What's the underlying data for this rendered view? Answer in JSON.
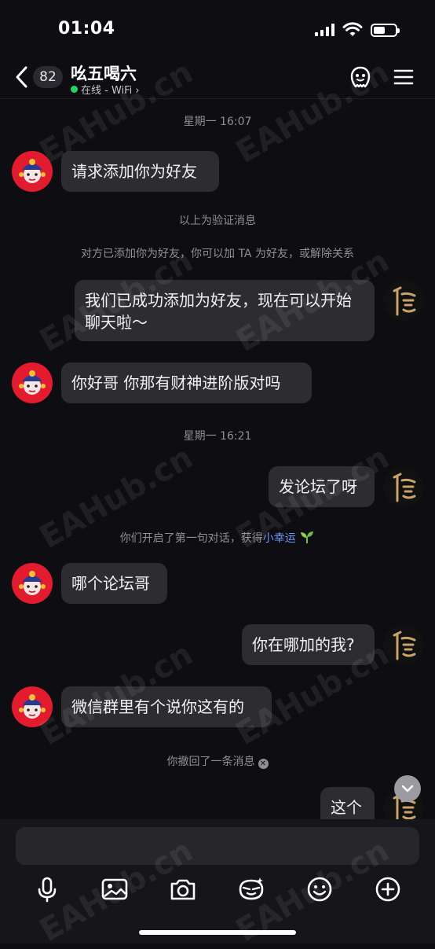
{
  "status": {
    "time": "01:04"
  },
  "header": {
    "unread": "82",
    "title": "吆五喝六",
    "status": "在线 - WiFi ›"
  },
  "chat": {
    "ts1": "星期一 16:07",
    "m1": "请求添加你为好友",
    "sys1": "以上为验证消息",
    "sys2": "对方已添加你为好友，你可以加 TA 为好友，或解除关系",
    "m2": "我们已成功添加为好友，现在可以开始聊天啦～",
    "m3": "你好哥 你那有财神进阶版对吗",
    "ts2": "星期一 16:21",
    "m4": "发论坛了呀",
    "sys3_prefix": "你们开启了第一句对话，获得",
    "sys3_link": "小幸运",
    "m5": "哪个论坛哥",
    "m6": "你在哪加的我?",
    "m7": "微信群里有个说你这有的",
    "sys4": "你撤回了一条消息",
    "m8": "这个"
  },
  "watermark": "EAHub.cn",
  "icons": [
    "back-chevron",
    "qq-show",
    "menu",
    "mic",
    "image",
    "camera",
    "sticker",
    "emoji",
    "plus"
  ]
}
